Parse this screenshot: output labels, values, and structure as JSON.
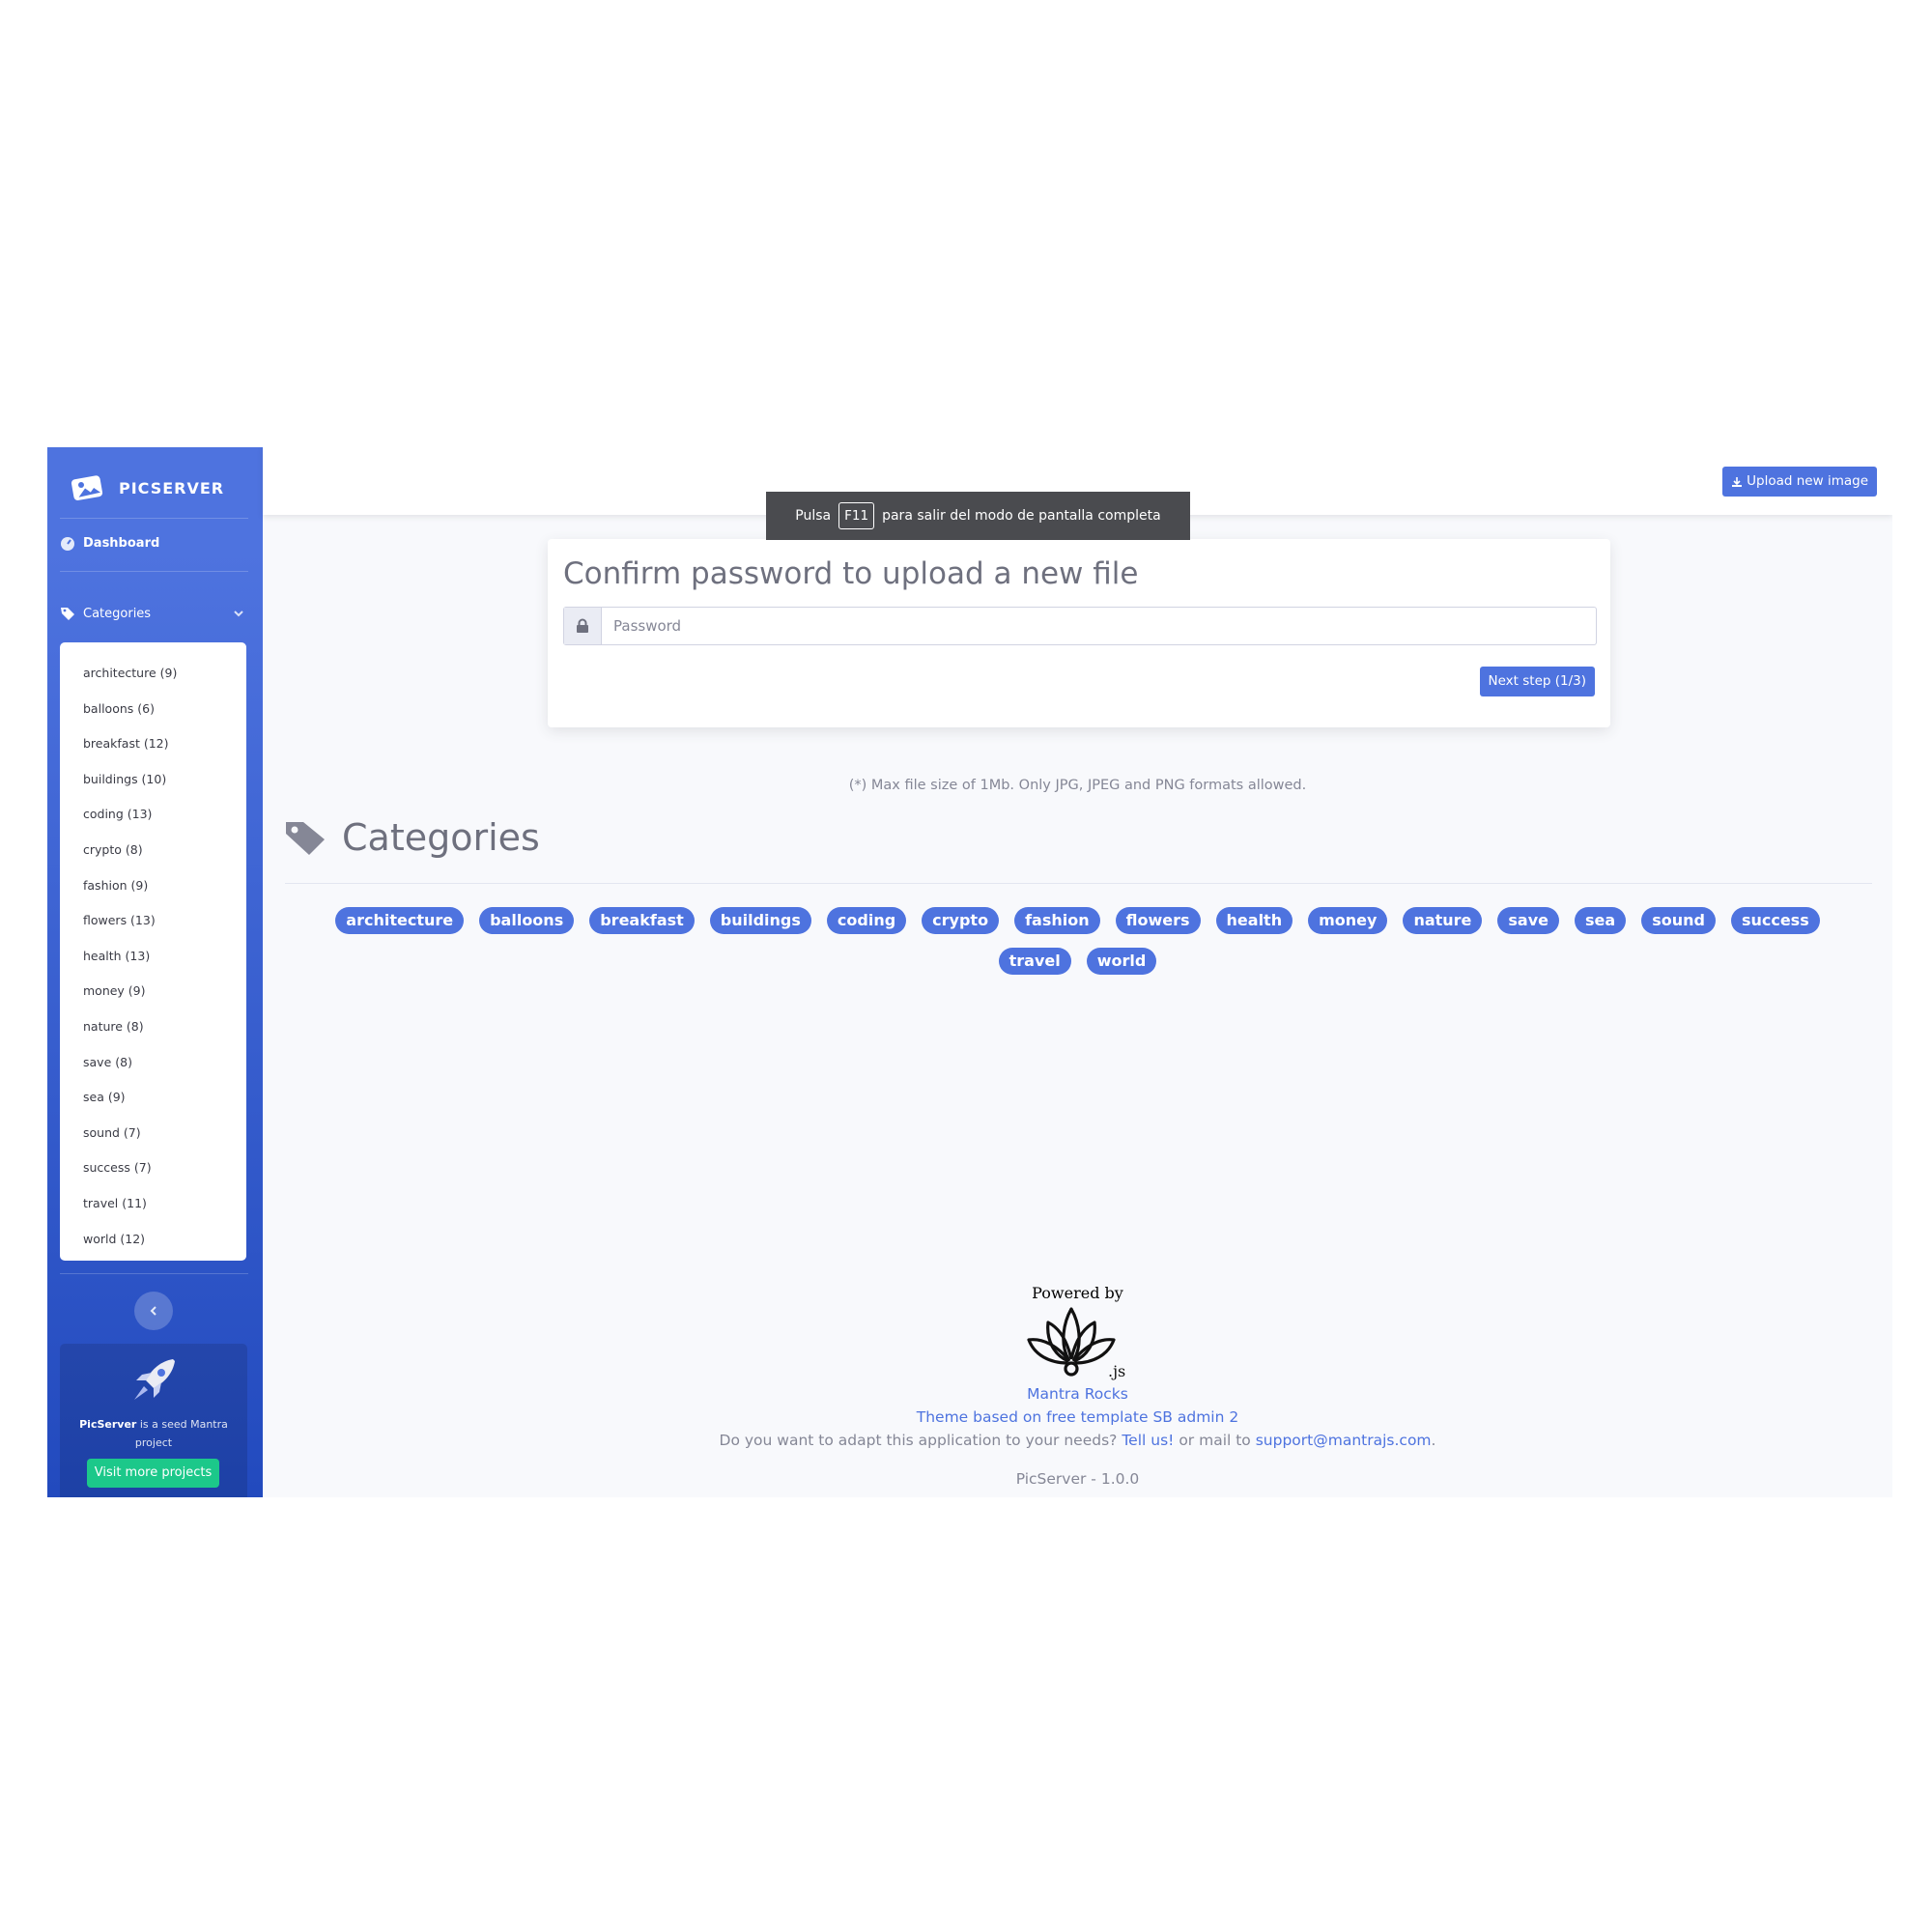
{
  "sidebar": {
    "brand": "PICSERVER",
    "dashboard": "Dashboard",
    "categories_label": "Categories",
    "categories": [
      "architecture (9)",
      "balloons (6)",
      "breakfast (12)",
      "buildings (10)",
      "coding (13)",
      "crypto (8)",
      "fashion (9)",
      "flowers (13)",
      "health (13)",
      "money (9)",
      "nature (8)",
      "save (8)",
      "sea (9)",
      "sound (7)",
      "success (7)",
      "travel (11)",
      "world (12)"
    ],
    "promo": {
      "name": "PicServer",
      "text": "is a seed Mantra project",
      "button": "Visit more projects"
    }
  },
  "topbar": {
    "upload_button": "Upload new image"
  },
  "toast": {
    "prefix": "Pulsa",
    "key": "F11",
    "suffix": "para salir del modo de pantalla completa"
  },
  "card": {
    "title": "Confirm password to upload a new file",
    "password_placeholder": "Password",
    "next_button": "Next step (1/3)"
  },
  "note": "(*) Max file size of 1Mb. Only JPG, JPEG and PNG formats allowed.",
  "categories_section": {
    "title": "Categories",
    "tags": [
      "architecture",
      "balloons",
      "breakfast",
      "buildings",
      "coding",
      "crypto",
      "fashion",
      "flowers",
      "health",
      "money",
      "nature",
      "save",
      "sea",
      "sound",
      "success",
      "travel",
      "world"
    ]
  },
  "footer": {
    "powered_by": "Powered by",
    "logo_suffix": ".js",
    "mantra": "Mantra Rocks",
    "theme": "Theme based on free template SB admin 2",
    "adapt_prefix": "Do you want to adapt this application to your needs?",
    "tell_us": "Tell us!",
    "adapt_mid": "or mail to",
    "email": "support@mantrajs.com",
    "adapt_end": ".",
    "version": "PicServer - 1.0.0"
  },
  "colors": {
    "primary": "#4e73df",
    "success": "#1cc88a",
    "text": "#858796"
  }
}
